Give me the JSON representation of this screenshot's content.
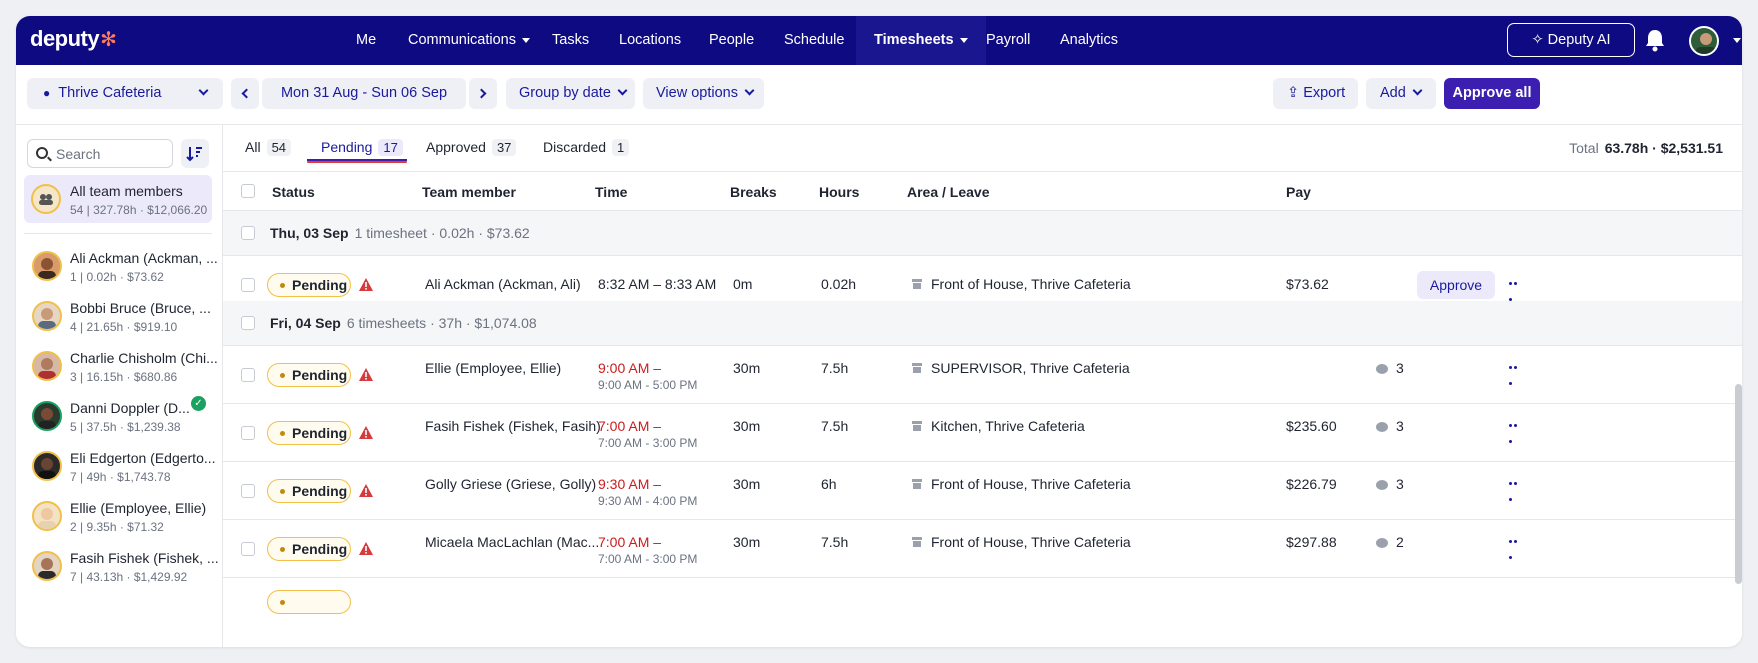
{
  "nav": {
    "logo": "deputy",
    "items": [
      "Me",
      "Communications",
      "Tasks",
      "Locations",
      "People",
      "Schedule",
      "Timesheets",
      "Payroll",
      "Analytics"
    ],
    "active": "Timesheets",
    "deputy_ai": "Deputy AI"
  },
  "toolbar": {
    "location": "Thrive Cafeteria",
    "date_range": "Mon 31 Aug - Sun 06 Sep",
    "group_by": "Group by date",
    "view_options": "View options",
    "export": "Export",
    "add": "Add",
    "approve_all": "Approve all"
  },
  "sidebar": {
    "search_placeholder": "Search",
    "all": {
      "name": "All team members",
      "sub": "54 | 327.78h · $12,066.20"
    },
    "members": [
      {
        "name": "Ali Ackman (Ackman, ...",
        "sub": "1 | 0.02h · $73.62"
      },
      {
        "name": "Bobbi Bruce (Bruce, ...",
        "sub": "4 | 21.65h · $919.10"
      },
      {
        "name": "Charlie Chisholm (Chi...",
        "sub": "3 | 16.15h · $680.86"
      },
      {
        "name": "Danni Doppler (D...",
        "sub": "5 | 37.5h · $1,239.38"
      },
      {
        "name": "Eli Edgerton (Edgerto...",
        "sub": "7 | 49h · $1,743.78"
      },
      {
        "name": "Ellie (Employee, Ellie)",
        "sub": "2 | 9.35h · $71.32"
      },
      {
        "name": "Fasih Fishek (Fishek, ...",
        "sub": "7 | 43.13h · $1,429.92"
      }
    ]
  },
  "tabs": [
    {
      "label": "All",
      "count": "54"
    },
    {
      "label": "Pending",
      "count": "17"
    },
    {
      "label": "Approved",
      "count": "37"
    },
    {
      "label": "Discarded",
      "count": "1"
    }
  ],
  "total": {
    "label": "Total",
    "value": "63.78h · $2,531.51"
  },
  "columns": [
    "Status",
    "Team member",
    "Time",
    "Breaks",
    "Hours",
    "Area / Leave",
    "Pay"
  ],
  "groups": [
    {
      "date": "Thu, 03 Sep",
      "summary": "1 timesheet · 0.02h · $73.62"
    },
    {
      "date": "Fri, 04 Sep",
      "summary": "6 timesheets · 37h · $1,074.08"
    }
  ],
  "rows": [
    {
      "status": "Pending",
      "member": "Ali Ackman (Ackman, Ali)",
      "time": "8:32 AM – 8:33 AM",
      "time_sub": "",
      "breaks": "0m",
      "hours": "0.02h",
      "area": "Front of House, Thrive Cafeteria",
      "pay": "$73.62",
      "comments": "",
      "action": "Approve"
    },
    {
      "status": "Pending",
      "member": "Ellie (Employee, Ellie)",
      "time": "9:00 AM –",
      "time_sub": "9:00 AM - 5:00 PM",
      "breaks": "30m",
      "hours": "7.5h",
      "area": "SUPERVISOR, Thrive Cafeteria",
      "pay": "",
      "comments": "3"
    },
    {
      "status": "Pending",
      "member": "Fasih Fishek (Fishek, Fasih)",
      "time": "7:00 AM –",
      "time_sub": "7:00 AM - 3:00 PM",
      "breaks": "30m",
      "hours": "7.5h",
      "area": "Kitchen, Thrive Cafeteria",
      "pay": "$235.60",
      "comments": "3"
    },
    {
      "status": "Pending",
      "member": "Golly Griese (Griese, Golly)",
      "time": "9:30 AM –",
      "time_sub": "9:30 AM - 4:00 PM",
      "breaks": "30m",
      "hours": "6h",
      "area": "Front of House, Thrive Cafeteria",
      "pay": "$226.79",
      "comments": "3"
    },
    {
      "status": "Pending",
      "member": "Micaela MacLachlan (Mac...",
      "time": "7:00 AM –",
      "time_sub": "7:00 AM - 3:00 PM",
      "breaks": "30m",
      "hours": "7.5h",
      "area": "Front of House, Thrive Cafeteria",
      "pay": "$297.88",
      "comments": "2"
    }
  ],
  "colors": {
    "nav_bg": "#0e0a82",
    "accent": "#3c1fb0",
    "pending_border": "#f0c04a",
    "warning": "#d63a3a",
    "late_time": "#c81d1d"
  }
}
